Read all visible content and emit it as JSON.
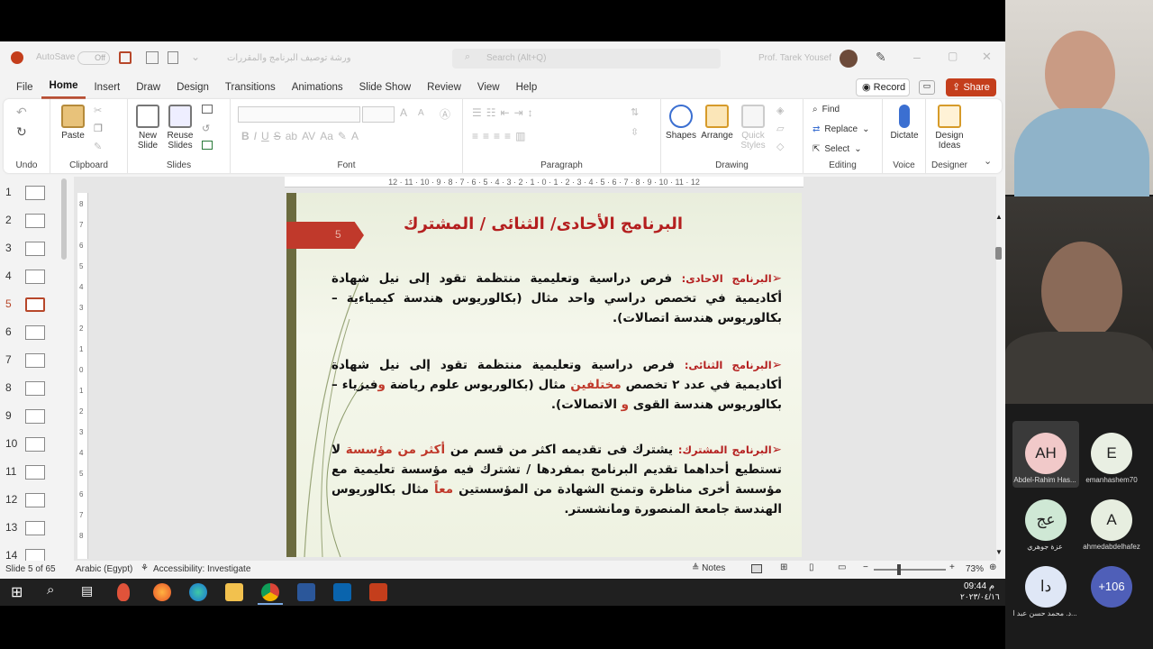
{
  "titlebar": {
    "autosave_label": "AutoSave",
    "autosave_state": "Off",
    "doc_title": "ورشة توصيف البرنامج والمقررات",
    "search_placeholder": "Search (Alt+Q)",
    "user_name": "Prof. Tarek Yousef"
  },
  "tabs": [
    "File",
    "Home",
    "Insert",
    "Draw",
    "Design",
    "Transitions",
    "Animations",
    "Slide Show",
    "Review",
    "View",
    "Help"
  ],
  "active_tab": "Home",
  "record_label": "Record",
  "share_label": "Share",
  "ribbon": {
    "undo_label": "Undo",
    "clipboard": {
      "label": "Clipboard",
      "paste": "Paste"
    },
    "slides": {
      "label": "Slides",
      "new_slide": "New Slide",
      "reuse_slides": "Reuse Slides"
    },
    "font_label": "Font",
    "paragraph_label": "Paragraph",
    "drawing": {
      "label": "Drawing",
      "shapes": "Shapes",
      "arrange": "Arrange",
      "quick_styles": "Quick Styles"
    },
    "editing": {
      "label": "Editing",
      "find": "Find",
      "replace": "Replace",
      "select": "Select"
    },
    "voice": {
      "label": "Voice",
      "dictate": "Dictate"
    },
    "designer": {
      "label": "Designer",
      "design_ideas": "Design Ideas"
    }
  },
  "ruler_text": "12 · 11 · 10 · 9 · 8 · 7 · 6 · 5 · 4 · 3 · 2 · 1 · 0 · 1 · 2 · 3 · 4 · 5 · 6 · 7 · 8 · 9 · 10 · 11 · 12",
  "thumbnails": [
    "1",
    "2",
    "3",
    "4",
    "5",
    "6",
    "7",
    "8",
    "9",
    "10",
    "11",
    "12",
    "13",
    "14"
  ],
  "selected_slide": 5,
  "slide": {
    "number": "5",
    "title": "البرنامج الأحادى/ الثنائى / المشترك",
    "p1": {
      "label": "البرنامج الاحادى:",
      "text": " فرص دراسية وتعليمية منتظمة تقود إلى نيل شهادة أكاديمية في تخصص دراسي واحد مثال (بكالوريوس هندسة كيمياءية – بكالوريوس هندسة اتصالات)."
    },
    "p2": {
      "label": "البرنامج الثنائى:",
      "text_a": " فرص دراسية وتعليمية منتظمة تقود إلى نيل شهادة أكاديمية في عدد ٢ تخصص ",
      "red_a": "مختلفين",
      "text_b": " مثال (بكالوريوس علوم رياضة ",
      "red_b": "و",
      "text_c": "فيزياء – بكالوريوس هندسة القوى ",
      "red_c": "و",
      "text_d": " الاتصالات)."
    },
    "p3": {
      "label": "البرنامج المشترك:",
      "text_a": " يشترك فى تقديمه اكثر من قسم من ",
      "red_a": "أكثر من مؤسسة",
      "text_b": " لا تستطيع أحداهما تقديم البرنامج بمفردها / تشترك فيه مؤسسة تعليمية مع مؤسسة أخرى مناظرة وتمنح الشهادة من المؤسستين ",
      "red_b": "معاً",
      "text_c": " مثال بكالوريوس الهندسة جامعة المنصورة ومانشستر."
    }
  },
  "statusbar": {
    "slide_info": "Slide 5 of 65",
    "language": "Arabic (Egypt)",
    "accessibility": "Accessibility: Investigate",
    "notes": "Notes",
    "zoom": "73%"
  },
  "taskbar": {
    "time": "09:44 م",
    "date": "٢٠٢٣/٠٤/١٦"
  },
  "participants": [
    {
      "initials": "AH",
      "name": "Abdel-Rahim Has...",
      "color": "#f1c9c9"
    },
    {
      "initials": "E",
      "name": "emanhashem70",
      "color": "#e9efe3"
    },
    {
      "initials": "عج",
      "name": "عزة جوهري",
      "color": "#cfe8d5"
    },
    {
      "initials": "A",
      "name": "ahmedabdelhafez",
      "color": "#e7eee0"
    },
    {
      "initials": "دا",
      "name": "د. محمد حسن عبد ا...",
      "color": "#dfe7f6"
    },
    {
      "initials": "+106",
      "name": "",
      "color": "#4f5fb8"
    }
  ]
}
